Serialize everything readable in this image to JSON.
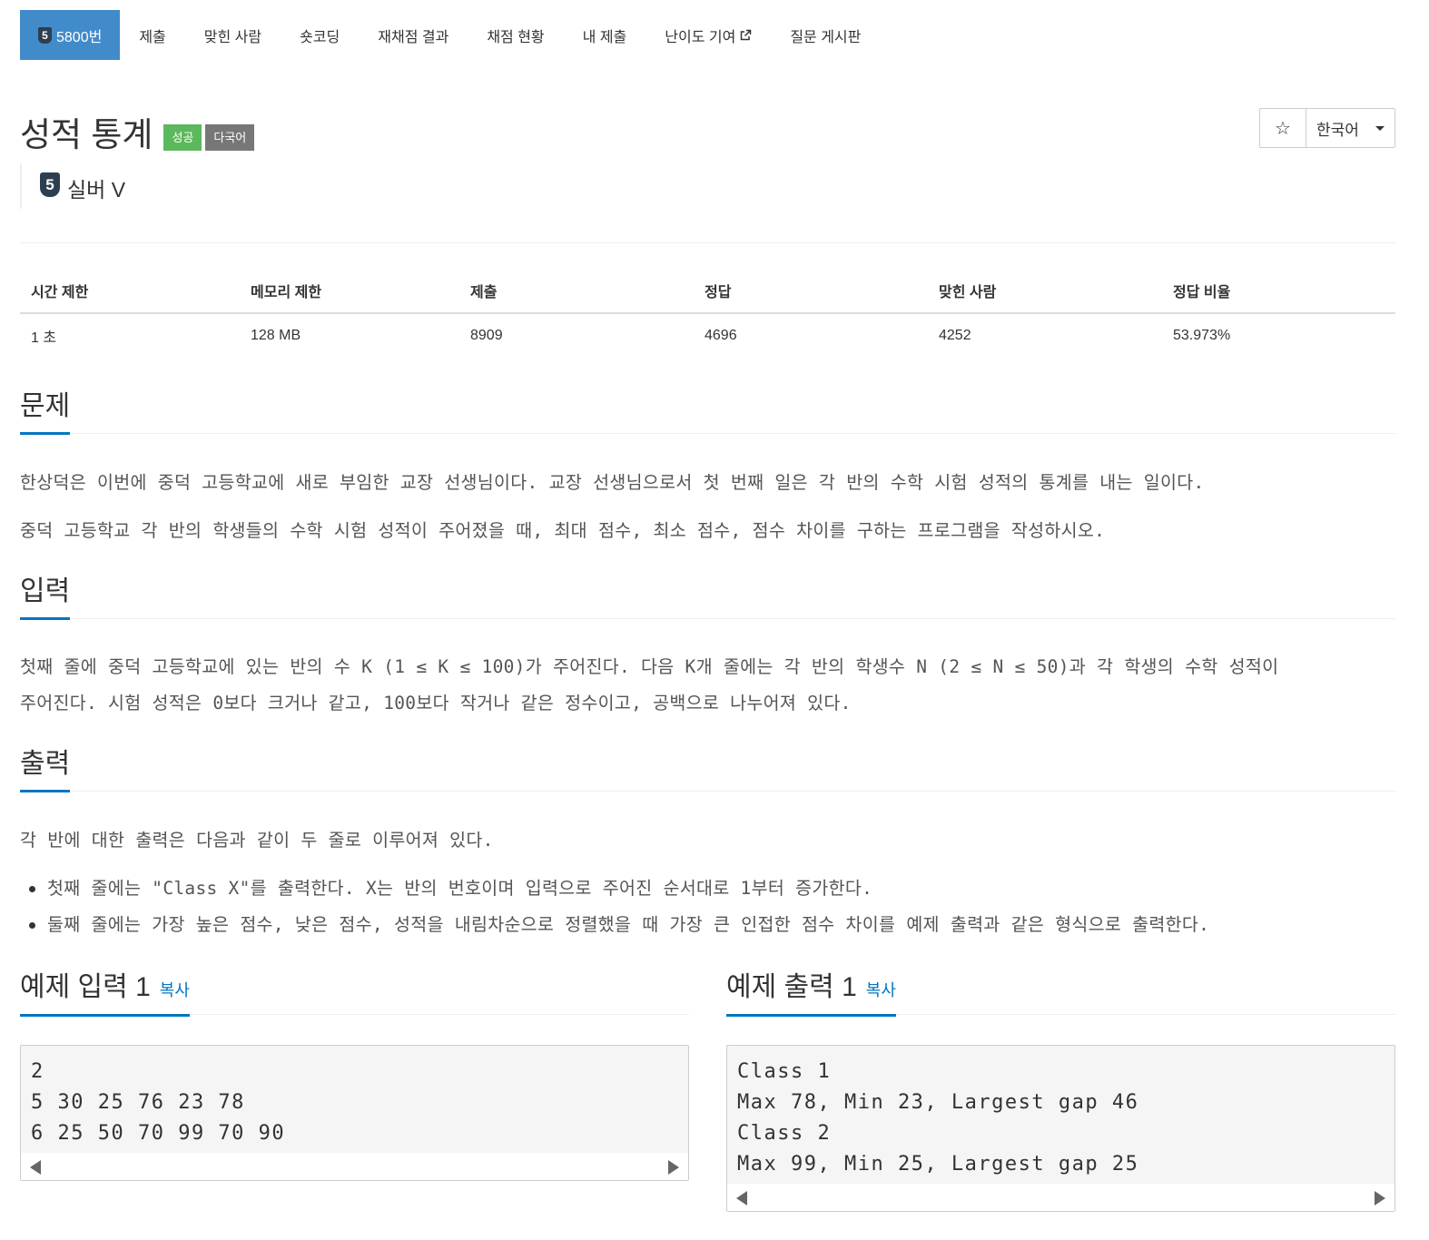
{
  "nav": {
    "problem_tier": "5",
    "problem_number": "5800번",
    "items": [
      "제출",
      "맞힌 사람",
      "숏코딩",
      "재채점 결과",
      "채점 현황",
      "내 제출",
      "난이도 기여",
      "질문 게시판"
    ]
  },
  "problem": {
    "title": "성적 통계",
    "label_success": "성공",
    "label_multilang": "다국어",
    "tier_number": "5",
    "tier_name": "실버 V"
  },
  "toolbar": {
    "star_icon": "☆",
    "language": "한국어"
  },
  "info_table": {
    "headers": [
      "시간 제한",
      "메모리 제한",
      "제출",
      "정답",
      "맞힌 사람",
      "정답 비율"
    ],
    "values": [
      "1 초",
      "128 MB",
      "8909",
      "4696",
      "4252",
      "53.973%"
    ]
  },
  "sections": {
    "problem_heading": "문제",
    "problem_p1": "한상덕은 이번에 중덕 고등학교에 새로 부임한 교장 선생님이다. 교장 선생님으로서 첫 번째 일은 각 반의 수학 시험 성적의 통계를 내는 일이다.",
    "problem_p2": "중덕 고등학교 각 반의 학생들의 수학 시험 성적이 주어졌을 때, 최대 점수, 최소 점수, 점수 차이를 구하는 프로그램을 작성하시오.",
    "input_heading": "입력",
    "input_line1": "첫째 줄에 중덕 고등학교에 있는 반의 수 K (1 ≤ K ≤ 100)가 주어진다. 다음 K개 줄에는 각 반의 학생수 N (2 ≤ N ≤ 50)과 각 학생의 수학 성적이",
    "input_line2": "주어진다. 시험 성적은 0보다 크거나 같고, 100보다 작거나 같은 정수이고, 공백으로 나누어져 있다.",
    "output_heading": "출력",
    "output_p": "각 반에 대한 출력은 다음과 같이 두 줄로 이루어져 있다.",
    "output_items": [
      "첫째 줄에는 \"Class X\"를 출력한다. X는 반의 번호이며 입력으로 주어진 순서대로 1부터 증가한다.",
      "둘째 줄에는 가장 높은 점수, 낮은 점수, 성적을 내림차순으로 정렬했을 때 가장 큰 인접한 점수 차이를 예제 출력과 같은 형식으로 출력한다."
    ]
  },
  "samples": {
    "input_heading": "예제 입력 1",
    "output_heading": "예제 출력 1",
    "copy_label": "복사",
    "input_lines": [
      "2",
      "5 30 25 76 23 78",
      "6 25 50 70 99 70 90"
    ],
    "output_lines": [
      "Class 1",
      "Max 78, Min 23, Largest gap 46",
      "Class 2",
      "Max 99, Min 25, Largest gap 25"
    ]
  }
}
